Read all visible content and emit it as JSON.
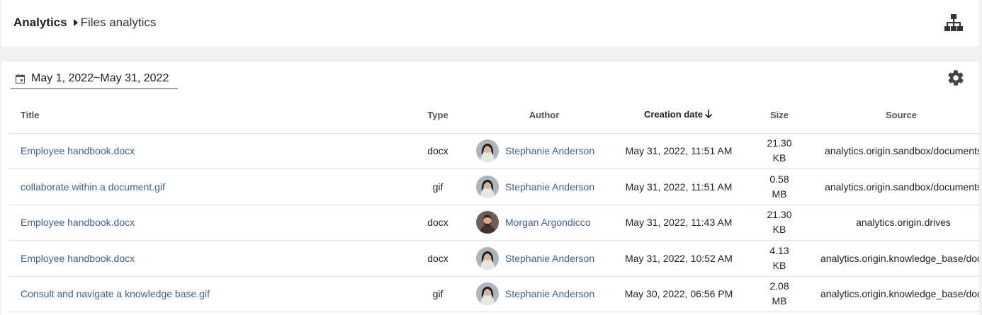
{
  "header": {
    "breadcrumb_root": "Analytics",
    "breadcrumb_current": "Files analytics",
    "sitemap_icon": "sitemap-icon"
  },
  "filter": {
    "date_range": "May 1, 2022~May 31, 2022",
    "calendar_icon": "calendar-icon",
    "settings_icon": "gear-icon"
  },
  "table": {
    "columns": {
      "title": "Title",
      "type": "Type",
      "author": "Author",
      "creation_date": "Creation date",
      "size": "Size",
      "source": "Source"
    },
    "sort": {
      "column": "creation_date",
      "direction": "descending"
    },
    "rows": [
      {
        "title": "Employee handbook.docx",
        "type": "docx",
        "author": "Stephanie Anderson",
        "avatar": "female",
        "date": "May 31, 2022, 11:51 AM",
        "size_value": "21.30",
        "size_unit": "KB",
        "source": "analytics.origin.sandbox/documents"
      },
      {
        "title": "collaborate within a document.gif",
        "type": "gif",
        "author": "Stephanie Anderson",
        "avatar": "female",
        "date": "May 31, 2022, 11:51 AM",
        "size_value": "0.58",
        "size_unit": "MB",
        "source": "analytics.origin.sandbox/documents"
      },
      {
        "title": "Employee handbook.docx",
        "type": "docx",
        "author": "Morgan Argondicco",
        "avatar": "male",
        "date": "May 31, 2022, 11:43 AM",
        "size_value": "21.30",
        "size_unit": "KB",
        "source": "analytics.origin.drives"
      },
      {
        "title": "Employee handbook.docx",
        "type": "docx",
        "author": "Stephanie Anderson",
        "avatar": "female",
        "date": "May 31, 2022, 10:52 AM",
        "size_value": "4.13",
        "size_unit": "KB",
        "source": "analytics.origin.knowledge_base/documents"
      },
      {
        "title": "Consult and navigate a knowledge base.gif",
        "type": "gif",
        "author": "Stephanie Anderson",
        "avatar": "female",
        "date": "May 30, 2022, 06:56 PM",
        "size_value": "2.08",
        "size_unit": "MB",
        "source": "analytics.origin.knowledge_base/documents"
      }
    ]
  }
}
